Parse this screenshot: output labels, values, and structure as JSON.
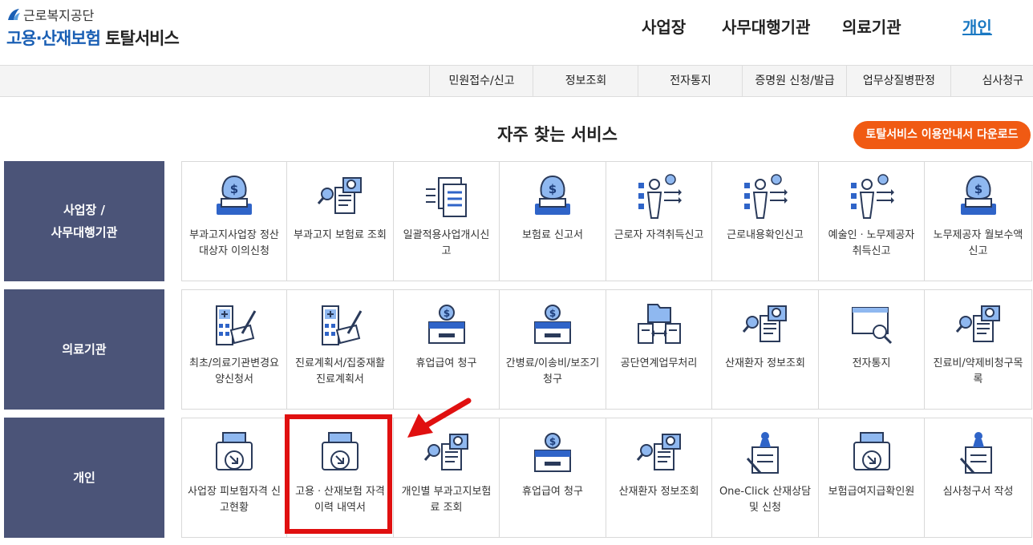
{
  "header": {
    "org_name": "근로복지공단",
    "service_title_blue": "고용·산재보험",
    "service_title_dark": "토탈서비스",
    "nav": [
      "사업장",
      "사무대행기관",
      "의료기관",
      "개인"
    ],
    "active_nav": "개인"
  },
  "subnav": [
    "민원접수/신고",
    "정보조회",
    "전자통지",
    "증명원 신청/발급",
    "업무상질병판정",
    "심사청구"
  ],
  "section_title": "자주 찾는 서비스",
  "download_button": "토탈서비스 이용안내서 다운로드",
  "colors": {
    "accent_blue": "#2f64c8",
    "row_label_bg": "#4b5478",
    "download_orange": "#f05a13",
    "highlight_red": "#e01010"
  },
  "rows": [
    {
      "label_lines": [
        "사업장 /",
        "사무대행기관"
      ],
      "tiles": [
        {
          "icon": "money-bag-laptop-icon",
          "label": "부과고지사업장 정산대상자 이의신청"
        },
        {
          "icon": "document-search-icon",
          "label": "부과고지 보험료 조회"
        },
        {
          "icon": "document-list-icon",
          "label": "일괄적용사업개시신고"
        },
        {
          "icon": "money-bag-laptop-icon",
          "label": "보험료 신고서"
        },
        {
          "icon": "worker-checklist-icon",
          "label": "근로자 자격취득신고"
        },
        {
          "icon": "worker-checklist-icon",
          "label": "근로내용확인신고"
        },
        {
          "icon": "worker-checklist-icon",
          "label": "예술인ㆍ노무제공자 취득신고"
        },
        {
          "icon": "money-bag-laptop-icon",
          "label": "노무제공자 월보수액 신고"
        }
      ]
    },
    {
      "label_lines": [
        "의료기관"
      ],
      "tiles": [
        {
          "icon": "hospital-document-icon",
          "label": "최초/의료기관변경요양신청서"
        },
        {
          "icon": "hospital-document-icon",
          "label": "진료계획서/집중재활진료계획서"
        },
        {
          "icon": "coin-box-icon",
          "label": "휴업급여 청구"
        },
        {
          "icon": "coin-box-icon",
          "label": "간병료/이송비/보조기 청구"
        },
        {
          "icon": "folder-exchange-icon",
          "label": "공단연계업무처리"
        },
        {
          "icon": "document-search-icon",
          "label": "산재환자 정보조회"
        },
        {
          "icon": "envelope-search-icon",
          "label": "전자통지"
        },
        {
          "icon": "document-search-icon",
          "label": "진료비/약제비청구목록"
        }
      ]
    },
    {
      "label_lines": [
        "개인"
      ],
      "tiles": [
        {
          "icon": "printer-download-icon",
          "label": "사업장 피보험자격 신고현황"
        },
        {
          "icon": "printer-download-icon",
          "label": "고용ㆍ산재보험 자격 이력 내역서"
        },
        {
          "icon": "document-search-icon",
          "label": "개인별 부과고지보험료 조회"
        },
        {
          "icon": "coin-box-icon",
          "label": "휴업급여 청구"
        },
        {
          "icon": "document-search-icon",
          "label": "산재환자 정보조회"
        },
        {
          "icon": "stamp-pen-icon",
          "label": "One-Click 산재상담 및 신청"
        },
        {
          "icon": "printer-download-icon",
          "label": "보험급여지급확인원"
        },
        {
          "icon": "stamp-pen-icon",
          "label": "심사청구서 작성"
        }
      ]
    }
  ]
}
